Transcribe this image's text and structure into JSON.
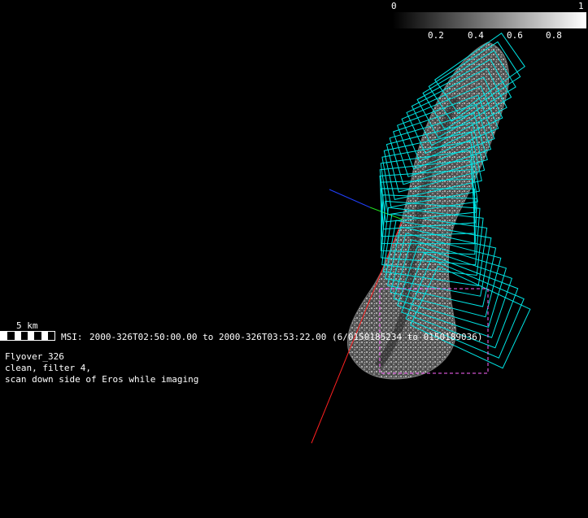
{
  "colorbar": {
    "min_label": "0",
    "max_label": "1",
    "ticks": [
      "0.2",
      "0.4",
      "0.6",
      "0.8"
    ],
    "tick_values": [
      0.2,
      0.4,
      0.6,
      0.8
    ],
    "range": [
      0,
      1
    ],
    "gradient": "grayscale"
  },
  "scale": {
    "label": "5 km"
  },
  "msi": {
    "label": "MSI:",
    "time_range": "2000-326T02:50:00.00 to 2000-326T03:53:22.00 (6/0150185234 to 0150189036)"
  },
  "notes": [
    "Flyover_326",
    "clean, filter 4,",
    "scan down side of Eros while imaging"
  ],
  "colors": {
    "footprint": "#00e5e5",
    "footprint_highlight": "#ff66ff",
    "axis_x": "#ff2020",
    "axis_y": "#20e020",
    "axis_z": "#2040ff",
    "background": "#000000"
  }
}
